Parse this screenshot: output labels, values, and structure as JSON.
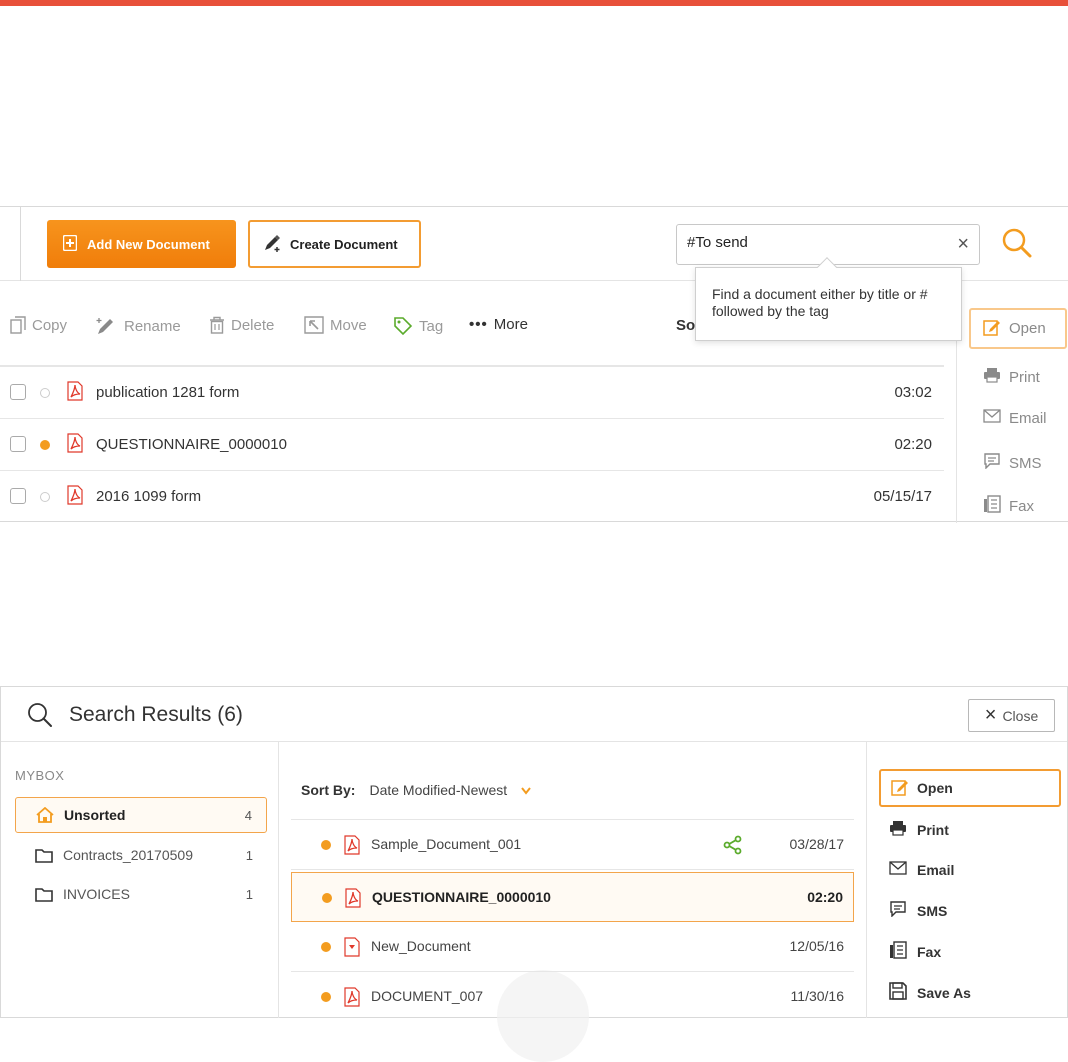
{
  "colors": {
    "accent": "#f39c1f",
    "topbar": "#e8503a",
    "pdf_red": "#e0392b",
    "share_green": "#5bab2c"
  },
  "panel1": {
    "add_button": "Add New Document",
    "create_button": "Create Document",
    "search": {
      "value": "#To send",
      "placeholder": ""
    },
    "tooltip": "Find a document either by title or # followed by the tag",
    "tools": {
      "copy": "Copy",
      "rename": "Rename",
      "delete": "Delete",
      "move": "Move",
      "tag": "Tag",
      "more": "More"
    },
    "sort_stub": "So",
    "rows": [
      {
        "name": "publication 1281 form",
        "date": "03:02",
        "status": "none"
      },
      {
        "name": "QUESTIONNAIRE_0000010",
        "date": "02:20",
        "status": "orange"
      },
      {
        "name": "2016 1099 form",
        "date": "05/15/17",
        "status": "none"
      }
    ],
    "side_actions": {
      "open": "Open",
      "print": "Print",
      "email": "Email",
      "sms": "SMS",
      "fax": "Fax"
    }
  },
  "panel2": {
    "title": "Search Results (6)",
    "close_button": "Close",
    "mybox_label": "MYBOX",
    "folders": [
      {
        "name": "Unsorted",
        "count": "4",
        "icon": "home-icon"
      },
      {
        "name": "Contracts_20170509",
        "count": "1",
        "icon": "folder-icon"
      },
      {
        "name": "INVOICES",
        "count": "1",
        "icon": "folder-icon"
      }
    ],
    "sort_by_label": "Sort By:",
    "sort_by_value": "Date Modified-Newest",
    "results": [
      {
        "name": "Sample_Document_001",
        "date": "03/28/17",
        "shared": true
      },
      {
        "name": "QUESTIONNAIRE_0000010",
        "date": "02:20",
        "selected": true
      },
      {
        "name": "New_Document",
        "date": "12/05/16"
      },
      {
        "name": "DOCUMENT_007",
        "date": "11/30/16"
      }
    ],
    "side_actions": {
      "open": "Open",
      "print": "Print",
      "email": "Email",
      "sms": "SMS",
      "fax": "Fax",
      "save_as": "Save As"
    }
  }
}
